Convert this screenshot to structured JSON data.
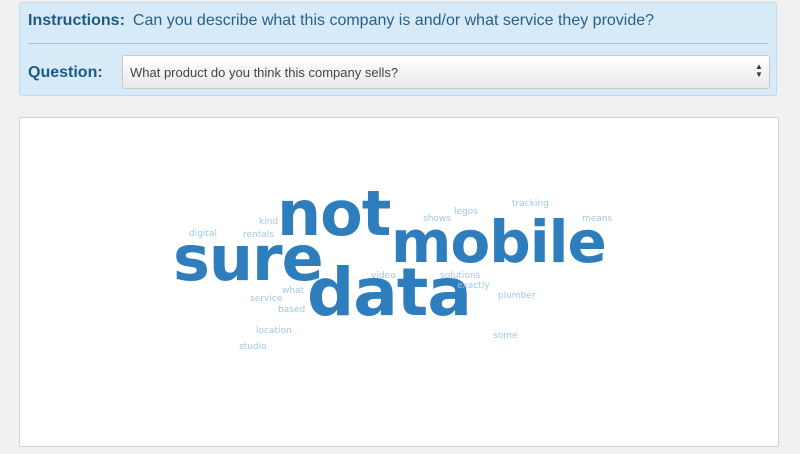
{
  "instructions": {
    "label": "Instructions:",
    "text": "Can you describe what this company is and/or what service they provide?"
  },
  "question": {
    "label": "Question:",
    "selected": "What product do you think this company sells?"
  },
  "icons": {
    "select_arrows": "up-down-arrows-icon"
  },
  "colors": {
    "panel_bg": "#d6ebf7",
    "accent": "#1f5a85",
    "cloud_big": "#2e7dbd",
    "cloud_small": "#9ec8e6"
  },
  "word_cloud": {
    "big": {
      "not": "not",
      "mobile": "mobile",
      "sure": "sure",
      "data": "data"
    },
    "small": {
      "kind": "kind",
      "digital": "digital",
      "rentals": "rentals",
      "shows": "shows",
      "legos": "legos",
      "tracking": "tracking",
      "means": "means",
      "video": "video",
      "solutions": "solutions",
      "exactly": "exactly",
      "what": "what",
      "service": "service",
      "based": "based",
      "plumber": "plumber",
      "location": "location",
      "studio": "studio",
      "some": "some"
    }
  }
}
